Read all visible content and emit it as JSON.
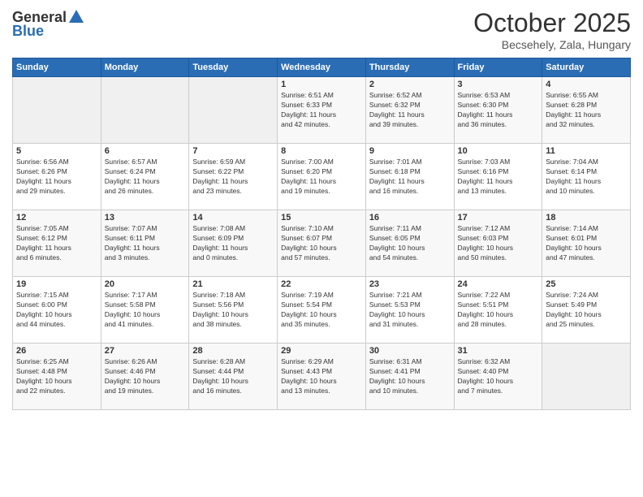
{
  "header": {
    "logo_general": "General",
    "logo_blue": "Blue",
    "month_title": "October 2025",
    "subtitle": "Becsehely, Zala, Hungary"
  },
  "days_of_week": [
    "Sunday",
    "Monday",
    "Tuesday",
    "Wednesday",
    "Thursday",
    "Friday",
    "Saturday"
  ],
  "weeks": [
    [
      {
        "day": "",
        "info": ""
      },
      {
        "day": "",
        "info": ""
      },
      {
        "day": "",
        "info": ""
      },
      {
        "day": "1",
        "info": "Sunrise: 6:51 AM\nSunset: 6:33 PM\nDaylight: 11 hours\nand 42 minutes."
      },
      {
        "day": "2",
        "info": "Sunrise: 6:52 AM\nSunset: 6:32 PM\nDaylight: 11 hours\nand 39 minutes."
      },
      {
        "day": "3",
        "info": "Sunrise: 6:53 AM\nSunset: 6:30 PM\nDaylight: 11 hours\nand 36 minutes."
      },
      {
        "day": "4",
        "info": "Sunrise: 6:55 AM\nSunset: 6:28 PM\nDaylight: 11 hours\nand 32 minutes."
      }
    ],
    [
      {
        "day": "5",
        "info": "Sunrise: 6:56 AM\nSunset: 6:26 PM\nDaylight: 11 hours\nand 29 minutes."
      },
      {
        "day": "6",
        "info": "Sunrise: 6:57 AM\nSunset: 6:24 PM\nDaylight: 11 hours\nand 26 minutes."
      },
      {
        "day": "7",
        "info": "Sunrise: 6:59 AM\nSunset: 6:22 PM\nDaylight: 11 hours\nand 23 minutes."
      },
      {
        "day": "8",
        "info": "Sunrise: 7:00 AM\nSunset: 6:20 PM\nDaylight: 11 hours\nand 19 minutes."
      },
      {
        "day": "9",
        "info": "Sunrise: 7:01 AM\nSunset: 6:18 PM\nDaylight: 11 hours\nand 16 minutes."
      },
      {
        "day": "10",
        "info": "Sunrise: 7:03 AM\nSunset: 6:16 PM\nDaylight: 11 hours\nand 13 minutes."
      },
      {
        "day": "11",
        "info": "Sunrise: 7:04 AM\nSunset: 6:14 PM\nDaylight: 11 hours\nand 10 minutes."
      }
    ],
    [
      {
        "day": "12",
        "info": "Sunrise: 7:05 AM\nSunset: 6:12 PM\nDaylight: 11 hours\nand 6 minutes."
      },
      {
        "day": "13",
        "info": "Sunrise: 7:07 AM\nSunset: 6:11 PM\nDaylight: 11 hours\nand 3 minutes."
      },
      {
        "day": "14",
        "info": "Sunrise: 7:08 AM\nSunset: 6:09 PM\nDaylight: 11 hours\nand 0 minutes."
      },
      {
        "day": "15",
        "info": "Sunrise: 7:10 AM\nSunset: 6:07 PM\nDaylight: 10 hours\nand 57 minutes."
      },
      {
        "day": "16",
        "info": "Sunrise: 7:11 AM\nSunset: 6:05 PM\nDaylight: 10 hours\nand 54 minutes."
      },
      {
        "day": "17",
        "info": "Sunrise: 7:12 AM\nSunset: 6:03 PM\nDaylight: 10 hours\nand 50 minutes."
      },
      {
        "day": "18",
        "info": "Sunrise: 7:14 AM\nSunset: 6:01 PM\nDaylight: 10 hours\nand 47 minutes."
      }
    ],
    [
      {
        "day": "19",
        "info": "Sunrise: 7:15 AM\nSunset: 6:00 PM\nDaylight: 10 hours\nand 44 minutes."
      },
      {
        "day": "20",
        "info": "Sunrise: 7:17 AM\nSunset: 5:58 PM\nDaylight: 10 hours\nand 41 minutes."
      },
      {
        "day": "21",
        "info": "Sunrise: 7:18 AM\nSunset: 5:56 PM\nDaylight: 10 hours\nand 38 minutes."
      },
      {
        "day": "22",
        "info": "Sunrise: 7:19 AM\nSunset: 5:54 PM\nDaylight: 10 hours\nand 35 minutes."
      },
      {
        "day": "23",
        "info": "Sunrise: 7:21 AM\nSunset: 5:53 PM\nDaylight: 10 hours\nand 31 minutes."
      },
      {
        "day": "24",
        "info": "Sunrise: 7:22 AM\nSunset: 5:51 PM\nDaylight: 10 hours\nand 28 minutes."
      },
      {
        "day": "25",
        "info": "Sunrise: 7:24 AM\nSunset: 5:49 PM\nDaylight: 10 hours\nand 25 minutes."
      }
    ],
    [
      {
        "day": "26",
        "info": "Sunrise: 6:25 AM\nSunset: 4:48 PM\nDaylight: 10 hours\nand 22 minutes."
      },
      {
        "day": "27",
        "info": "Sunrise: 6:26 AM\nSunset: 4:46 PM\nDaylight: 10 hours\nand 19 minutes."
      },
      {
        "day": "28",
        "info": "Sunrise: 6:28 AM\nSunset: 4:44 PM\nDaylight: 10 hours\nand 16 minutes."
      },
      {
        "day": "29",
        "info": "Sunrise: 6:29 AM\nSunset: 4:43 PM\nDaylight: 10 hours\nand 13 minutes."
      },
      {
        "day": "30",
        "info": "Sunrise: 6:31 AM\nSunset: 4:41 PM\nDaylight: 10 hours\nand 10 minutes."
      },
      {
        "day": "31",
        "info": "Sunrise: 6:32 AM\nSunset: 4:40 PM\nDaylight: 10 hours\nand 7 minutes."
      },
      {
        "day": "",
        "info": ""
      }
    ]
  ]
}
